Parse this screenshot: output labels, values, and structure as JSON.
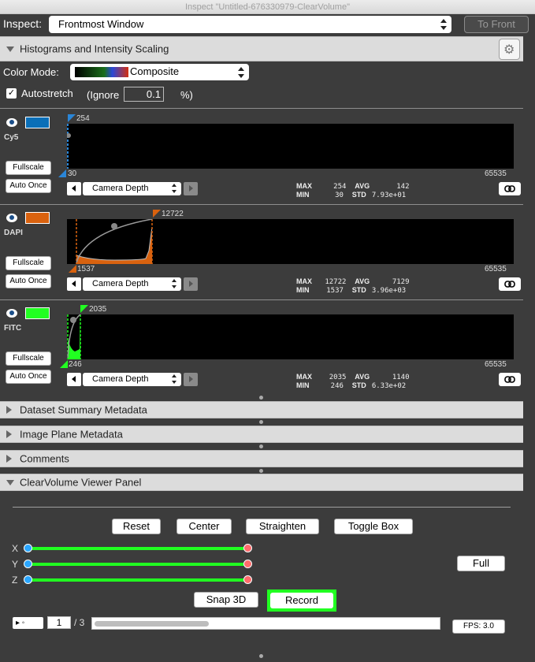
{
  "window": {
    "title": "Inspect \"Untitled-676330979-ClearVolume\""
  },
  "inspect": {
    "label": "Inspect:",
    "value": "Frontmost Window",
    "to_front": "To Front"
  },
  "histograms": {
    "header": "Histograms and Intensity Scaling",
    "color_mode_label": "Color Mode:",
    "color_mode_value": "Composite",
    "autostretch_label": "Autostretch",
    "autostretch_checked": true,
    "ignore_label": "(Ignore",
    "ignore_value": "0.1",
    "pct_label": "%)",
    "channels": [
      {
        "name": "Cy5",
        "color": "#0a6fb8",
        "max": "254",
        "min": "30",
        "range_max": "65535",
        "fullscale": "Fullscale",
        "auto_once": "Auto Once",
        "camera": "Camera Depth",
        "stats_max": "254",
        "stats_avg": "142",
        "stats_min": "30",
        "stats_std": "7.93e+01"
      },
      {
        "name": "DAPI",
        "color": "#d9620f",
        "max": "12722",
        "min": "1537",
        "range_max": "65535",
        "fullscale": "Fullscale",
        "auto_once": "Auto Once",
        "camera": "Camera Depth",
        "stats_max": "12722",
        "stats_avg": "7129",
        "stats_min": "1537",
        "stats_std": "3.96e+03"
      },
      {
        "name": "FITC",
        "color": "#21ff21",
        "max": "2035",
        "min": "246",
        "range_max": "65535",
        "fullscale": "Fullscale",
        "auto_once": "Auto Once",
        "camera": "Camera Depth",
        "stats_max": "2035",
        "stats_avg": "1140",
        "stats_min": "246",
        "stats_std": "6.33e+02"
      }
    ],
    "stat_labels": {
      "max": "MAX",
      "min": "MIN",
      "avg": "AVG",
      "std": "STD"
    }
  },
  "sections": {
    "dataset": "Dataset Summary Metadata",
    "image_plane": "Image Plane Metadata",
    "comments": "Comments",
    "clearvolume": "ClearVolume Viewer Panel"
  },
  "viewer": {
    "reset": "Reset",
    "center": "Center",
    "straighten": "Straighten",
    "toggle_box": "Toggle Box",
    "axes": [
      "X",
      "Y",
      "Z"
    ],
    "full": "Full",
    "snap3d": "Snap 3D",
    "record": "Record",
    "play": "▸  ◦",
    "frame": "1",
    "frame_total": "/ 3",
    "fps": "FPS: 3.0"
  }
}
